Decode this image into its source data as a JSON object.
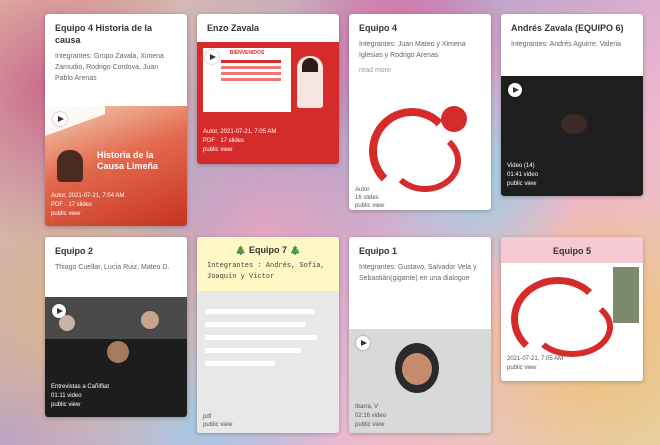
{
  "cards": [
    {
      "title": "Equipo 4 Historia de la causa",
      "desc": "Integrantes: Grupo Zavala, Ximena Zamudio, Rodrigo Cordova, Juan Pablo Arenas",
      "media_title": "Historia de la Causa Limeña",
      "cap1": "Autor, 2021-07-21, 7:04 AM",
      "cap2": "PDF · 17 slides",
      "cap3": "public view"
    },
    {
      "title": "Enzo Zavala",
      "media_label": "BIENVENIDOS",
      "cap1": "Autor, 2021-07-21, 7:05 AM",
      "cap2": "PDF · 17 slides",
      "cap3": "public view"
    },
    {
      "title": "Equipo 4",
      "desc": "Integrantes: Juan Mateo y Ximena Iglesias y Rodrigo Arenas",
      "more": "read more",
      "cap1": "Autor",
      "cap2": "16 slides",
      "cap3": "public view"
    },
    {
      "title": "Andrés Zavala (EQUIPO 6)",
      "desc": "Integrantes: Andrés Aguirre, Valeria",
      "cap1": "Video (14)",
      "cap2": "01:41 video",
      "cap3": "public view"
    },
    {
      "title": "Equipo 2",
      "desc": "Thiago Cuellar, Lucía Ruiz, Mateo D.",
      "cap1": "Entrevistas a Cañifliat",
      "cap2": "01:11 video",
      "cap3": "public view"
    },
    {
      "title": "Equipo 7",
      "emoji": "🎄",
      "desc": "Integrantes : Andrés, Sofía, Joaquín y Victor",
      "cap1": "pdf",
      "cap2": "public view"
    },
    {
      "title": "Equipo 1",
      "desc": "Integrantes: Gustavo, Salvador Vela y Sebastián(gigante) en una dialogue",
      "cap1": "Ibarra, V",
      "cap2": "02:16 video",
      "cap3": "public view"
    },
    {
      "title": "Equipo 5",
      "cap1": "2021-07-21, 7:05 AM",
      "cap2": "public view"
    }
  ],
  "colors": {
    "red": "#d62b2b",
    "card": "#ffffff",
    "yellow_card": "#fff7c4",
    "pink_header": "#f6c9d3"
  }
}
